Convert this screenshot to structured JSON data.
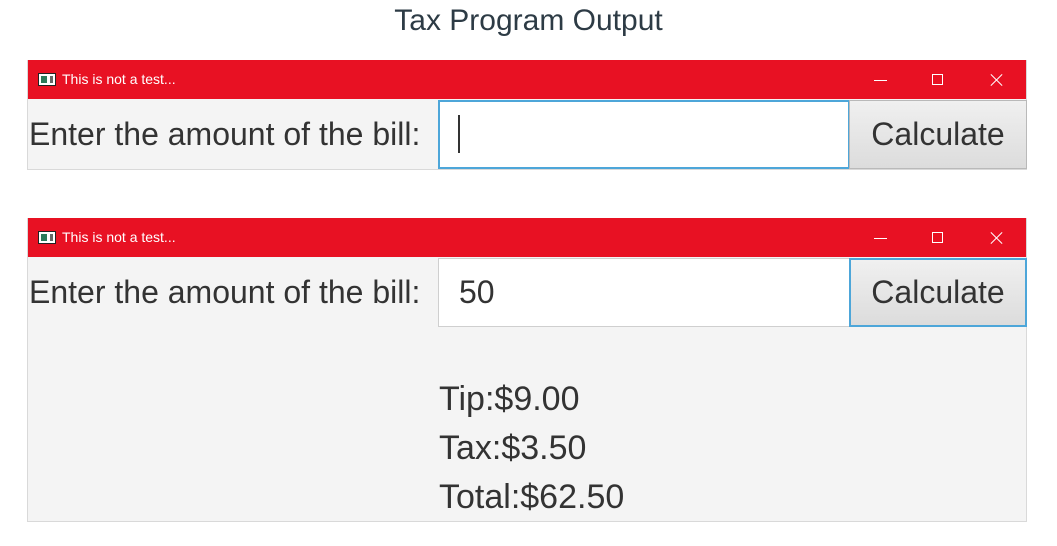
{
  "page": {
    "heading": "Tax Program Output"
  },
  "windows": [
    {
      "title": "This is not a test...",
      "label": "Enter the amount of the bill:",
      "input_value": "",
      "button_label": "Calculate",
      "results": []
    },
    {
      "title": "This is not a test...",
      "label": "Enter the amount of the bill:",
      "input_value": "50",
      "button_label": "Calculate",
      "results": [
        "Tip:$9.00",
        "Tax:$3.50",
        "Total:$62.50"
      ]
    }
  ],
  "colors": {
    "titlebar": "#e81123",
    "focus_border": "#4da6d9",
    "window_background": "#f4f4f4"
  },
  "icons": {
    "app": "java-app-icon",
    "minimize": "minimize-icon",
    "maximize": "maximize-icon",
    "close": "close-icon"
  }
}
